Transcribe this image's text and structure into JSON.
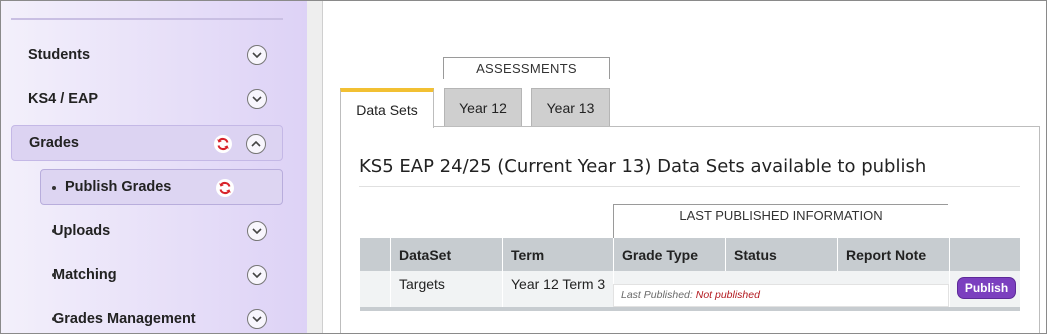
{
  "sidebar": {
    "items": [
      {
        "label": "Students",
        "icon": "chevron-down-icon"
      },
      {
        "label": "KS4 / EAP",
        "icon": "chevron-down-icon"
      },
      {
        "label": "Grades",
        "icon": "chevron-up-icon",
        "badge": "refresh-icon"
      },
      {
        "label": "Publish Grades",
        "badge": "refresh-icon"
      },
      {
        "label": "Uploads",
        "icon": "chevron-down-icon"
      },
      {
        "label": "Matching",
        "icon": "chevron-down-icon"
      },
      {
        "label": "Grades Management",
        "icon": "chevron-down-icon"
      }
    ],
    "bullet": "·"
  },
  "tabs": {
    "group_label": "ASSESSMENTS",
    "items": [
      "Data Sets",
      "Year 12",
      "Year 13"
    ],
    "selected": "Data Sets"
  },
  "panel": {
    "title": "KS5 EAP 24/25 (Current Year 13) Data Sets available to publish",
    "group_header": "LAST PUBLISHED INFORMATION",
    "columns": [
      "",
      "DataSet",
      "Term",
      "Grade Type",
      "Status",
      "Report Note",
      ""
    ],
    "rows": [
      {
        "dataset": "Targets",
        "term": "Year 12 Term 3",
        "last_published_label": "Last Published:",
        "last_published_value": "Not published",
        "action": "Publish"
      }
    ]
  },
  "colors": {
    "accent": "#7b3fbf",
    "tab_highlight": "#f2c033",
    "refresh_icon": "#d8232a",
    "not_published": "#b3191f"
  }
}
